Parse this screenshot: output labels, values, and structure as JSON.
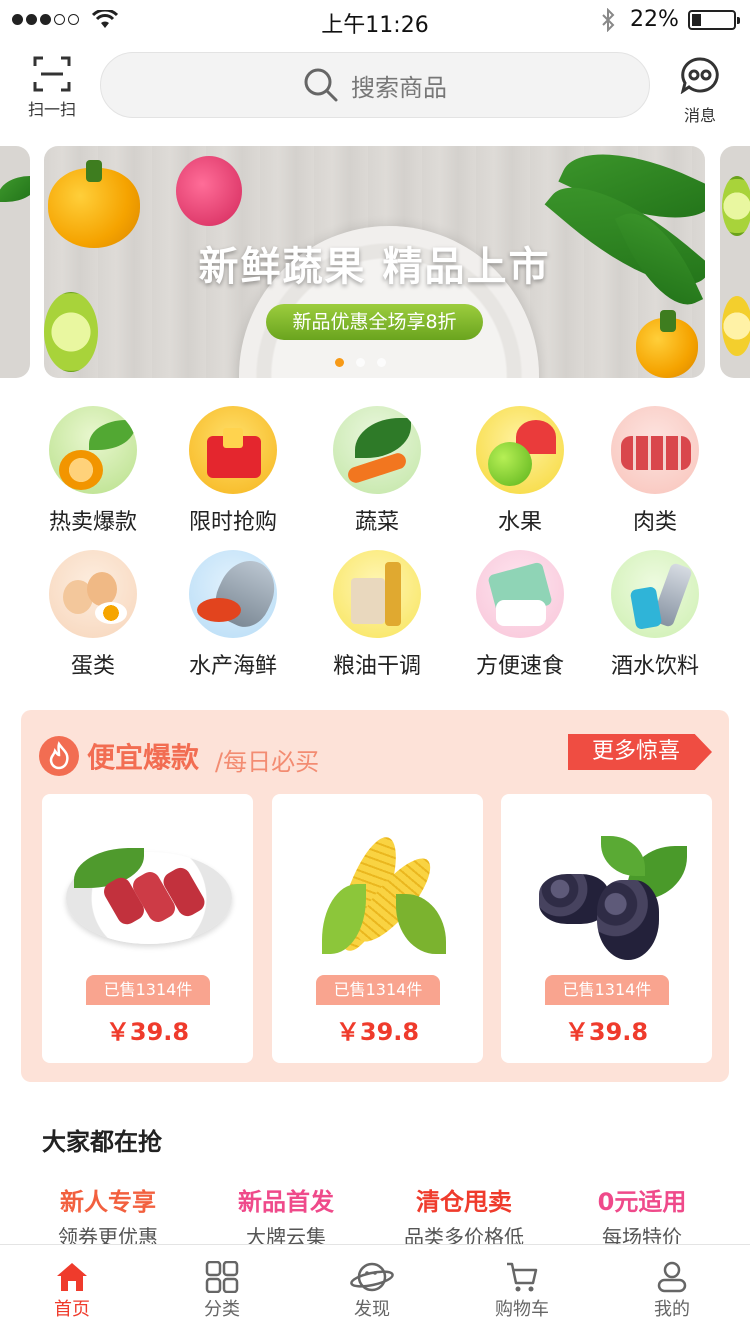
{
  "status_bar": {
    "time": "上午11:26",
    "battery": "22%"
  },
  "header": {
    "scan_label": "扫一扫",
    "search_placeholder": "搜索商品",
    "message_label": "消息"
  },
  "banner": {
    "title": "新鲜蔬果 精品上市",
    "subtitle": "新品优惠全场享8折",
    "active_dot": 1,
    "dot_count": 3
  },
  "categories": [
    {
      "label": "热卖爆款",
      "icon": "orange-icon"
    },
    {
      "label": "限时抢购",
      "icon": "red-packet-icon"
    },
    {
      "label": "蔬菜",
      "icon": "vegetable-icon"
    },
    {
      "label": "水果",
      "icon": "fruit-icon"
    },
    {
      "label": "肉类",
      "icon": "meat-icon"
    },
    {
      "label": "蛋类",
      "icon": "egg-icon"
    },
    {
      "label": "水产海鲜",
      "icon": "fish-icon"
    },
    {
      "label": "粮油干调",
      "icon": "oil-icon"
    },
    {
      "label": "方便速食",
      "icon": "snack-icon"
    },
    {
      "label": "酒水饮料",
      "icon": "bottle-icon"
    }
  ],
  "deals": {
    "title": "便宜爆款",
    "subtitle": "/每日必买",
    "more_label": "更多惊喜",
    "products": [
      {
        "name_icon": "beef-roll-icon",
        "sold": "已售1314件",
        "price": "￥39.8"
      },
      {
        "name_icon": "corn-icon",
        "sold": "已售1314件",
        "price": "￥39.8"
      },
      {
        "name_icon": "grape-icon",
        "sold": "已售1314件",
        "price": "￥39.8"
      }
    ]
  },
  "popular": {
    "title": "大家都在抢",
    "promos": [
      {
        "title": "新人专享",
        "subtitle": "领券更优惠",
        "color": "#f2603f"
      },
      {
        "title": "新品首发",
        "subtitle": "大牌云集",
        "color": "#ef4a8a"
      },
      {
        "title": "清仓甩卖",
        "subtitle": "品类多价格低",
        "color": "#ef3b2c"
      },
      {
        "title": "0元适用",
        "subtitle": "每场特价",
        "color": "#ef4a8a"
      }
    ]
  },
  "tabbar": [
    {
      "label": "首页",
      "icon": "home-icon",
      "active": true
    },
    {
      "label": "分类",
      "icon": "grid-icon",
      "active": false
    },
    {
      "label": "发现",
      "icon": "planet-icon",
      "active": false
    },
    {
      "label": "购物车",
      "icon": "cart-icon",
      "active": false
    },
    {
      "label": "我的",
      "icon": "user-icon",
      "active": false
    }
  ],
  "colors": {
    "accent": "#ef3b2c",
    "deal_bg": "#fde2d8",
    "banner_pill": "#8cc63a",
    "dot_active": "#f79a17"
  }
}
